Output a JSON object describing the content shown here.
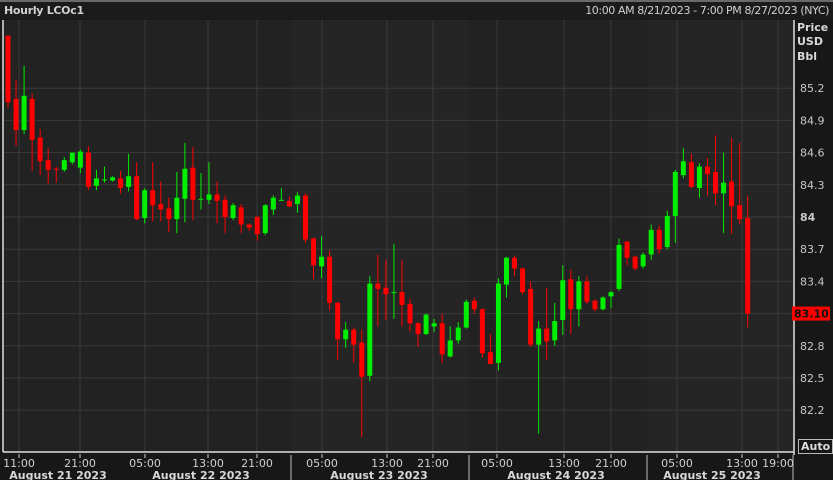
{
  "header": {
    "title": "Hourly LCOc1",
    "range": "10:00 AM 8/21/2023 - 7:00 PM 8/27/2023 (NYC)"
  },
  "axis_unit": [
    "Price",
    "USD",
    "Bbl"
  ],
  "auto_button": "Auto",
  "colors": {
    "up": "#00ee00",
    "down": "#ff0000",
    "background": "#222222",
    "grid": "#3a3a3a"
  },
  "chart_data": {
    "type": "candlestick",
    "title": "Hourly LCOc1",
    "ylabel": "Price USD Bbl",
    "ylim": [
      81.9,
      85.75
    ],
    "yticks": [
      "85.2",
      "84.9",
      "84.6",
      "84.3",
      "84",
      "83.7",
      "83.4",
      "83.1",
      "82.8",
      "82.5",
      "82.2"
    ],
    "ytick_values": [
      85.2,
      84.9,
      84.6,
      84.3,
      84,
      83.7,
      83.4,
      83.1,
      82.8,
      82.5,
      82.2
    ],
    "last_price": "83.10",
    "xtick_labels": [
      "11:00",
      "21:00",
      "05:00",
      "13:00",
      "21:00",
      "05:00",
      "13:00",
      "21:00",
      "05:00",
      "13:00",
      "21:00",
      "05:00",
      "13:00",
      "19:00"
    ],
    "day_labels": [
      "August 21 2023",
      "August 22 2023",
      "August 23 2023",
      "August 24 2023",
      "August 25 2023"
    ],
    "ohlc": [
      [
        85.69,
        85.69,
        85.02,
        85.07
      ],
      [
        85.1,
        85.28,
        84.66,
        84.81
      ],
      [
        84.81,
        85.41,
        84.77,
        85.13
      ],
      [
        85.1,
        85.15,
        84.43,
        84.72
      ],
      [
        84.74,
        84.82,
        84.39,
        84.52
      ],
      [
        84.53,
        84.64,
        84.31,
        84.44
      ],
      [
        84.45,
        84.47,
        84.32,
        84.44
      ],
      [
        84.44,
        84.56,
        84.42,
        84.53
      ],
      [
        84.51,
        84.6,
        84.49,
        84.6
      ],
      [
        84.46,
        84.63,
        84.41,
        84.61
      ],
      [
        84.6,
        84.66,
        84.25,
        84.28
      ],
      [
        84.29,
        84.44,
        84.25,
        84.36
      ],
      [
        84.35,
        84.47,
        84.32,
        84.35
      ],
      [
        84.34,
        84.38,
        84.33,
        84.37
      ],
      [
        84.36,
        84.43,
        84.22,
        84.27
      ],
      [
        84.28,
        84.59,
        84.24,
        84.38
      ],
      [
        84.38,
        84.51,
        83.97,
        83.98
      ],
      [
        83.99,
        84.27,
        83.94,
        84.25
      ],
      [
        84.25,
        84.51,
        83.96,
        84.11
      ],
      [
        84.12,
        84.33,
        83.96,
        84.07
      ],
      [
        84.08,
        84.18,
        83.86,
        83.98
      ],
      [
        83.98,
        84.42,
        83.85,
        84.18
      ],
      [
        84.17,
        84.69,
        83.95,
        84.45
      ],
      [
        84.46,
        84.65,
        83.97,
        84.16
      ],
      [
        84.17,
        84.41,
        84.07,
        84.17
      ],
      [
        84.16,
        84.51,
        84.12,
        84.21
      ],
      [
        84.21,
        84.33,
        83.94,
        84.15
      ],
      [
        84.16,
        84.2,
        83.85,
        84.0
      ],
      [
        83.99,
        84.13,
        83.97,
        84.11
      ],
      [
        84.09,
        84.12,
        83.85,
        83.93
      ],
      [
        83.93,
        83.94,
        83.87,
        83.9
      ],
      [
        84.0,
        84.01,
        83.78,
        83.84
      ],
      [
        83.85,
        84.12,
        83.83,
        84.11
      ],
      [
        84.07,
        84.2,
        84.02,
        84.18
      ],
      [
        84.16,
        84.27,
        84.15,
        84.16
      ],
      [
        84.15,
        84.19,
        84.09,
        84.1
      ],
      [
        84.12,
        84.23,
        84.04,
        84.2
      ],
      [
        84.2,
        84.22,
        83.76,
        83.79
      ],
      [
        83.8,
        83.81,
        83.42,
        83.55
      ],
      [
        83.54,
        83.82,
        83.43,
        83.63
      ],
      [
        83.63,
        83.69,
        83.13,
        83.2
      ],
      [
        83.2,
        83.21,
        82.67,
        82.86
      ],
      [
        82.86,
        83.02,
        82.78,
        82.95
      ],
      [
        82.95,
        82.97,
        82.64,
        82.81
      ],
      [
        82.83,
        82.95,
        81.95,
        82.51
      ],
      [
        82.52,
        83.45,
        82.47,
        83.38
      ],
      [
        83.38,
        83.65,
        82.98,
        83.33
      ],
      [
        83.34,
        83.6,
        83.04,
        83.28
      ],
      [
        83.3,
        83.75,
        83.05,
        83.3
      ],
      [
        83.3,
        83.6,
        82.98,
        83.18
      ],
      [
        83.19,
        83.24,
        82.93,
        83.01
      ],
      [
        83.01,
        83.02,
        82.79,
        82.91
      ],
      [
        82.91,
        83.1,
        82.9,
        83.09
      ],
      [
        82.98,
        83.05,
        82.93,
        83.01
      ],
      [
        83.01,
        83.1,
        82.64,
        82.72
      ],
      [
        82.7,
        82.98,
        82.69,
        82.85
      ],
      [
        82.85,
        83.02,
        82.82,
        82.97
      ],
      [
        82.97,
        83.23,
        82.96,
        83.21
      ],
      [
        83.22,
        83.25,
        83.1,
        83.14
      ],
      [
        83.14,
        83.15,
        82.69,
        82.73
      ],
      [
        82.74,
        82.91,
        82.63,
        82.63
      ],
      [
        82.64,
        83.43,
        82.57,
        83.38
      ],
      [
        83.37,
        83.63,
        83.25,
        83.62
      ],
      [
        83.62,
        83.64,
        83.45,
        83.52
      ],
      [
        83.52,
        83.53,
        83.28,
        83.3
      ],
      [
        83.33,
        83.4,
        82.79,
        82.81
      ],
      [
        82.81,
        83.03,
        81.98,
        82.96
      ],
      [
        82.96,
        83.34,
        82.67,
        82.84
      ],
      [
        82.85,
        83.2,
        82.8,
        83.03
      ],
      [
        83.04,
        83.55,
        82.9,
        83.41
      ],
      [
        83.42,
        83.51,
        82.91,
        83.14
      ],
      [
        83.14,
        83.45,
        82.98,
        83.4
      ],
      [
        83.4,
        83.45,
        83.19,
        83.21
      ],
      [
        83.22,
        83.23,
        83.12,
        83.14
      ],
      [
        83.14,
        83.26,
        83.13,
        83.25
      ],
      [
        83.26,
        83.31,
        83.15,
        83.3
      ],
      [
        83.33,
        83.8,
        83.31,
        83.74
      ],
      [
        83.77,
        83.78,
        83.55,
        83.62
      ],
      [
        83.63,
        83.64,
        83.5,
        83.52
      ],
      [
        83.54,
        83.67,
        83.52,
        83.65
      ],
      [
        83.65,
        83.93,
        83.6,
        83.88
      ],
      [
        83.88,
        83.92,
        83.66,
        83.7
      ],
      [
        83.72,
        84.06,
        83.7,
        84.01
      ],
      [
        84.01,
        84.44,
        83.76,
        84.42
      ],
      [
        84.39,
        84.64,
        84.36,
        84.52
      ],
      [
        84.51,
        84.59,
        84.27,
        84.28
      ],
      [
        84.27,
        84.5,
        84.18,
        84.47
      ],
      [
        84.47,
        84.55,
        84.2,
        84.4
      ],
      [
        84.42,
        84.76,
        84.11,
        84.22
      ],
      [
        84.22,
        84.6,
        83.85,
        84.32
      ],
      [
        84.33,
        84.74,
        83.84,
        84.1
      ],
      [
        84.11,
        84.69,
        83.93,
        83.98
      ],
      [
        83.99,
        84.2,
        82.97,
        83.1
      ]
    ]
  }
}
